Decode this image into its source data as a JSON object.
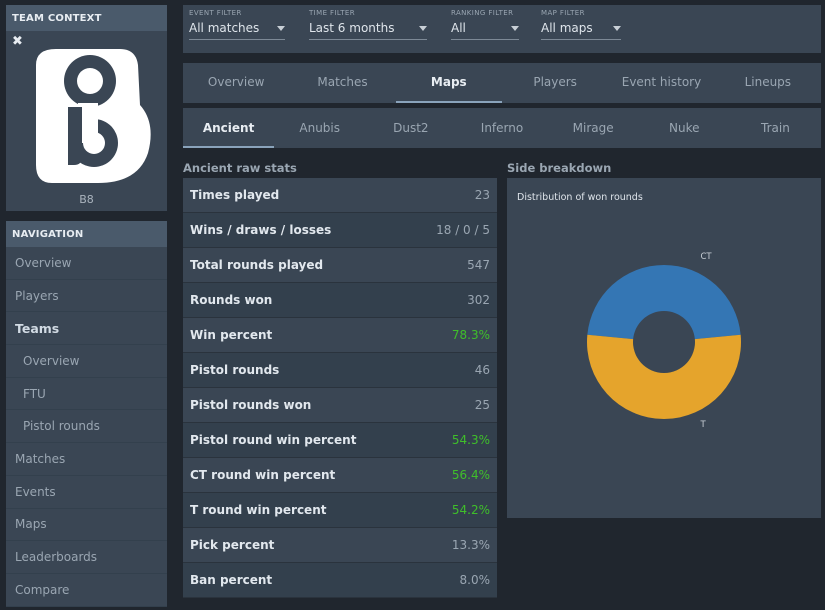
{
  "team_panel": {
    "header": "TEAM CONTEXT",
    "close_glyph": "✖",
    "team_name": "B8",
    "logo": "b8-logo-icon"
  },
  "navigation": {
    "header": "NAVIGATION",
    "items": [
      {
        "label": "Overview"
      },
      {
        "label": "Players"
      },
      {
        "label": "Teams",
        "active": true
      },
      {
        "label": "Overview",
        "sub": true
      },
      {
        "label": "FTU",
        "sub": true
      },
      {
        "label": "Pistol rounds",
        "sub": true
      },
      {
        "label": "Matches"
      },
      {
        "label": "Events"
      },
      {
        "label": "Maps"
      },
      {
        "label": "Leaderboards"
      },
      {
        "label": "Compare"
      }
    ]
  },
  "filters": [
    {
      "label": "EVENT FILTER",
      "value": "All matches"
    },
    {
      "label": "TIME FILTER",
      "value": "Last 6 months"
    },
    {
      "label": "RANKING FILTER",
      "value": "All"
    },
    {
      "label": "MAP FILTER",
      "value": "All maps"
    }
  ],
  "main_tabs": [
    {
      "label": "Overview"
    },
    {
      "label": "Matches"
    },
    {
      "label": "Maps",
      "active": true
    },
    {
      "label": "Players"
    },
    {
      "label": "Event history"
    },
    {
      "label": "Lineups"
    }
  ],
  "map_tabs": [
    {
      "label": "Ancient",
      "active": true
    },
    {
      "label": "Anubis"
    },
    {
      "label": "Dust2"
    },
    {
      "label": "Inferno"
    },
    {
      "label": "Mirage"
    },
    {
      "label": "Nuke"
    },
    {
      "label": "Train"
    }
  ],
  "stats": {
    "title": "Ancient raw stats",
    "rows": [
      {
        "name": "Times played",
        "value": "23"
      },
      {
        "name": "Wins / draws / losses",
        "value": "18 / 0 / 5"
      },
      {
        "name": "Total rounds played",
        "value": "547"
      },
      {
        "name": "Rounds won",
        "value": "302"
      },
      {
        "name": "Win percent",
        "value": "78.3%",
        "positive": true
      },
      {
        "name": "Pistol rounds",
        "value": "46"
      },
      {
        "name": "Pistol rounds won",
        "value": "25"
      },
      {
        "name": "Pistol round win percent",
        "value": "54.3%",
        "positive": true
      },
      {
        "name": "CT round win percent",
        "value": "56.4%",
        "positive": true
      },
      {
        "name": "T round win percent",
        "value": "54.2%",
        "positive": true
      },
      {
        "name": "Pick percent",
        "value": "13.3%"
      },
      {
        "name": "Ban percent",
        "value": "8.0%"
      }
    ]
  },
  "breakdown": {
    "title": "Side breakdown",
    "chart_title": "Distribution of won rounds"
  },
  "chart_data": {
    "type": "pie",
    "title": "Distribution of won rounds",
    "categories": [
      "CT",
      "T"
    ],
    "values": [
      47,
      53
    ],
    "colors": [
      "#3476b4",
      "#e5a42c"
    ],
    "donut": true
  },
  "colors": {
    "positive": "#3fbf2a",
    "panel": "#3a4654",
    "background": "#20262e"
  }
}
